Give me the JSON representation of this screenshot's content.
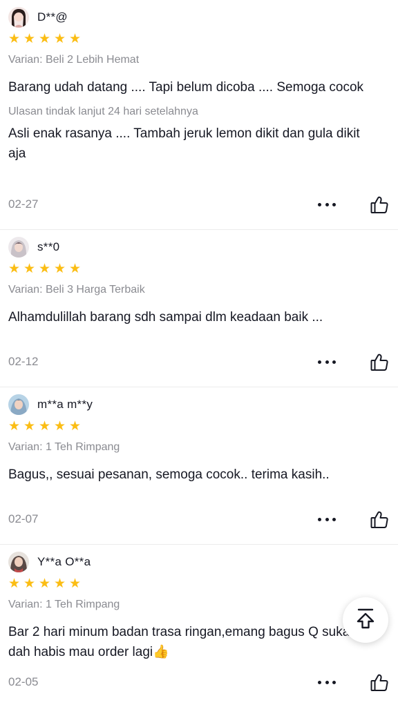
{
  "reviews": [
    {
      "username": "D**@",
      "rating": 5,
      "variant": "Varian: Beli 2 Lebih Hemat",
      "text": "Barang udah datang .... Tapi belum dicoba .... Semoga cocok",
      "followup_label": "Ulasan tindak lanjut 24 hari setelahnya",
      "followup_text": "Asli enak rasanya .... Tambah jeruk lemon dikit dan gula dikit aja",
      "date": "02-27"
    },
    {
      "username": "s**0",
      "rating": 5,
      "variant": "Varian: Beli 3 Harga Terbaik",
      "text": "Alhamdulillah barang sdh sampai dlm keadaan baik ...",
      "date": "02-12"
    },
    {
      "username": "m**a m**y",
      "rating": 5,
      "variant": "Varian: 1 Teh Rimpang",
      "text": "Bagus,, sesuai pesanan, semoga cocok.. terima kasih..",
      "date": "02-07"
    },
    {
      "username": "Y**a O**a",
      "rating": 5,
      "variant": "Varian: 1 Teh Rimpang",
      "text": "Bar 2 hari minum badan trasa ringan,emang bagus Q suka klo dah habis mau order lagi👍",
      "date": "02-05"
    }
  ],
  "icons": {
    "star": "star-icon",
    "more": "more-horizontal-icon",
    "like": "thumbs-up-icon",
    "scroll_top": "arrow-up-to-top-icon"
  },
  "colors": {
    "star": "#fbbd14",
    "muted_text": "#8a8b91",
    "primary_text": "#161823"
  }
}
